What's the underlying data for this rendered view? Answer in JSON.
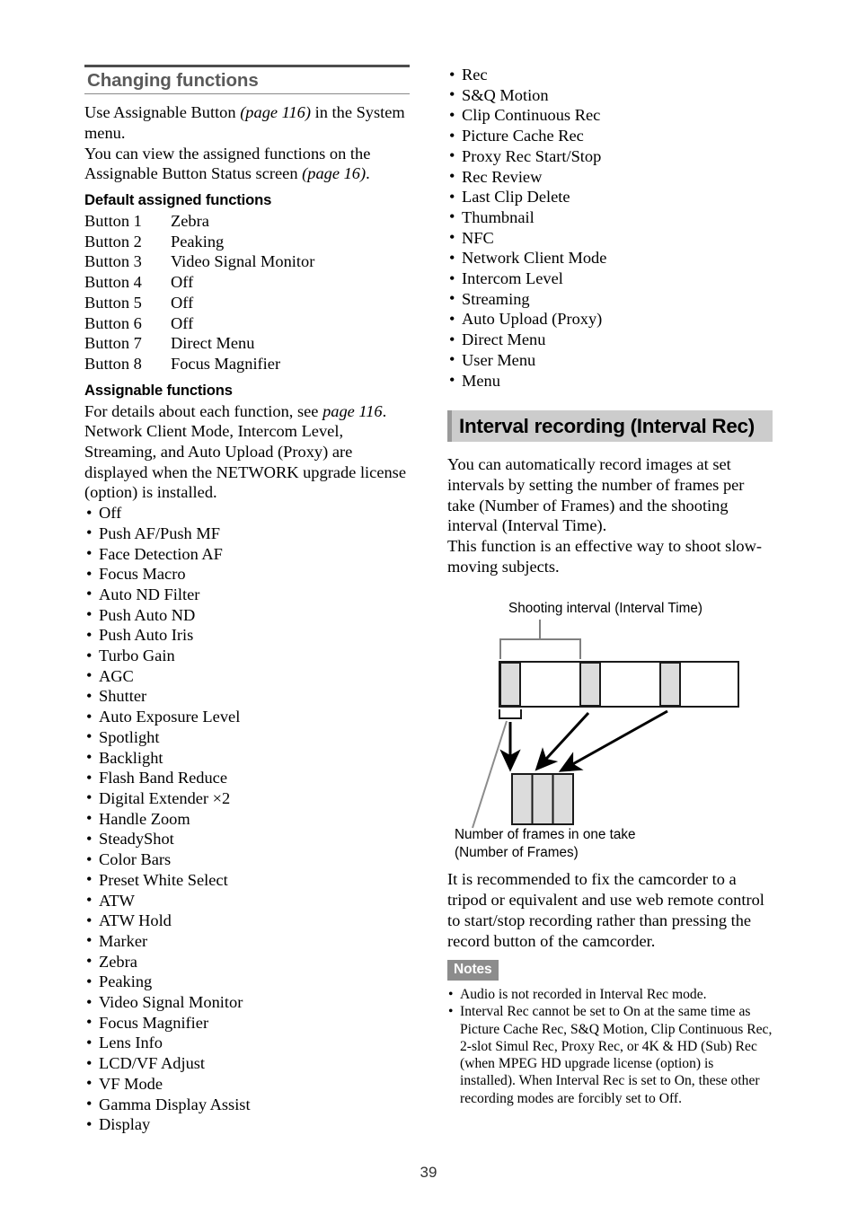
{
  "page": {
    "number": "39"
  },
  "left_column": {
    "section_heading": "Changing functions",
    "intro": {
      "line1_pre": "Use Assignable Button ",
      "line1_italic": "(page 116)",
      "line1_post": " in the System menu.",
      "line2_pre": "You can view the assigned functions on the Assignable Button Status screen ",
      "line2_italic": "(page 16)",
      "line2_post": "."
    },
    "default_heading": "Default assigned functions",
    "default_assignments": [
      {
        "button": "Button 1",
        "function": "Zebra"
      },
      {
        "button": "Button 2",
        "function": "Peaking"
      },
      {
        "button": "Button 3",
        "function": "Video Signal Monitor"
      },
      {
        "button": "Button 4",
        "function": "Off"
      },
      {
        "button": "Button 5",
        "function": "Off"
      },
      {
        "button": "Button 6",
        "function": "Off"
      },
      {
        "button": "Button 7",
        "function": "Direct Menu"
      },
      {
        "button": "Button 8",
        "function": "Focus Magnifier"
      }
    ],
    "assignable_heading": "Assignable functions",
    "assignable_intro_pre": "For details about each function, see ",
    "assignable_intro_italic": "page 116",
    "assignable_intro_post": ". Network Client Mode, Intercom Level, Streaming, and Auto Upload (Proxy) are displayed when the NETWORK upgrade license (option) is installed.",
    "assignable_functions": [
      "Off",
      "Push AF/Push MF",
      "Face Detection AF",
      "Focus Macro",
      "Auto ND Filter",
      "Push Auto ND",
      "Push Auto Iris",
      "Turbo Gain",
      "AGC",
      "Shutter",
      "Auto Exposure Level",
      "Spotlight",
      "Backlight",
      "Flash Band Reduce",
      "Digital Extender ×2",
      "Handle Zoom",
      "SteadyShot",
      "Color Bars",
      "Preset White Select",
      "ATW",
      "ATW Hold",
      "Marker",
      "Zebra",
      "Peaking",
      "Video Signal Monitor",
      "Focus Magnifier",
      "Lens Info",
      "LCD/VF Adjust",
      "VF Mode",
      "Gamma Display Assist",
      "Display"
    ]
  },
  "right_column": {
    "assignable_functions_continued": [
      "Rec",
      "S&Q Motion",
      "Clip Continuous Rec",
      "Picture Cache Rec",
      "Proxy Rec Start/Stop",
      "Rec Review",
      "Last Clip Delete",
      "Thumbnail",
      "NFC",
      "Network Client Mode",
      "Intercom Level",
      "Streaming",
      "Auto Upload (Proxy)",
      "Direct Menu",
      "User Menu",
      "Menu"
    ],
    "chapter_heading": "Interval recording (Interval Rec)",
    "chapter_intro": "You can automatically record images at set intervals by setting the number of frames per take (Number of Frames) and the shooting interval (Interval Time).",
    "chapter_intro2": "This function is an effective way to shoot slow-moving subjects.",
    "diagram": {
      "top_label": "Shooting interval (Interval Time)",
      "bottom_label_line1": "Number of frames in one take",
      "bottom_label_line2": "(Number of Frames)"
    },
    "recommendation": "It is recommended to fix the camcorder to a tripod or equivalent and use web remote control to start/stop recording rather than pressing the record button of the camcorder.",
    "notes_label": "Notes",
    "notes": [
      "Audio is not recorded in Interval Rec mode.",
      "Interval Rec cannot be set to On at the same time as Picture Cache Rec, S&Q Motion, Clip Continuous Rec, 2-slot Simul Rec, Proxy Rec, or 4K & HD (Sub) Rec (when MPEG HD upgrade license (option) is installed). When Interval Rec is set to On, these other recording modes are forcibly set to Off."
    ]
  },
  "colors": {
    "heading_gray": "#5a5a5a",
    "band_gray": "#cccccc",
    "band_marker": "#9a9a9a",
    "notes_badge_gray": "#8c8c8c",
    "diagram_cell_fill": "#dcdcdc",
    "diagram_bracket": "#808080"
  }
}
